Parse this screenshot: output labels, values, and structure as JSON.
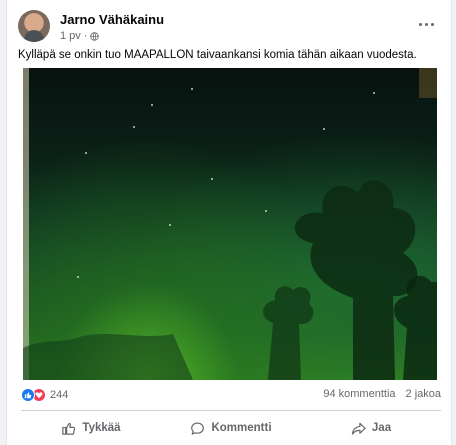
{
  "post": {
    "author": "Jarno Vähäkainu",
    "time": "1 pv",
    "separator": "·",
    "text": "Kylläpä se onkin tuo MAAPALLON taivaankansi komia tähän aikaan vuodesta."
  },
  "stats": {
    "reaction_count": "244",
    "comments": "94 kommenttia",
    "shares": "2 jakoa"
  },
  "actions": {
    "like": "Tykkää",
    "comment": "Kommentti",
    "share": "Jaa"
  },
  "colors": {
    "like_blue": "#1877f2",
    "love_red": "#f33e58",
    "secondary_text": "#65676b"
  },
  "icons": [
    "globe-icon",
    "more-options-icon",
    "like-reaction-icon",
    "love-reaction-icon",
    "thumbs-up-icon",
    "comment-icon",
    "share-icon"
  ]
}
